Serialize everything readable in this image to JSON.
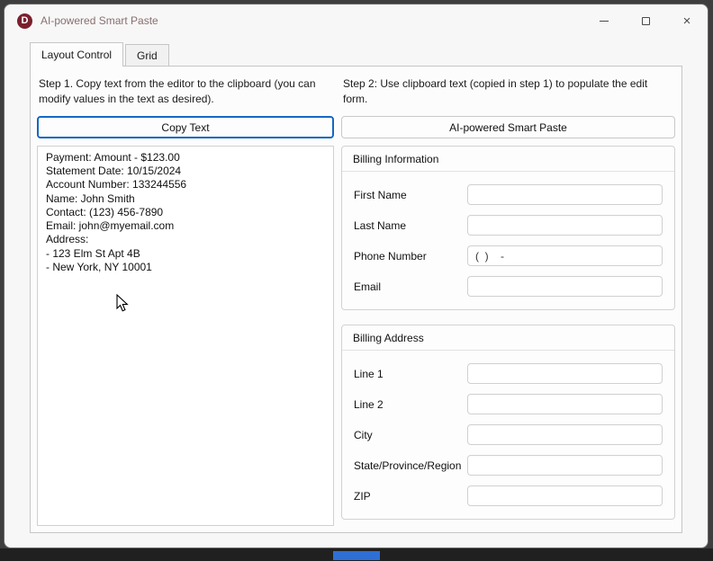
{
  "window": {
    "title": "AI-powered Smart Paste",
    "icon_letter": "D",
    "controls": {
      "close_glyph": "×"
    }
  },
  "colors": {
    "brand_red": "#7b1f2e",
    "focus_blue": "#1467c4",
    "taskbar_accent": "#2e6fd6"
  },
  "tabs": [
    {
      "label": "Layout Control",
      "active": true
    },
    {
      "label": "Grid",
      "active": false
    }
  ],
  "left": {
    "instruction": "Step 1. Copy text from the editor to the clipboard (you can modify values in the text as desired).",
    "copy_button_label": "Copy Text",
    "editor_text": "Payment: Amount - $123.00\nStatement Date: 10/15/2024\nAccount Number: 133244556\nName: John Smith\nContact: (123) 456-7890\nEmail: john@myemail.com\nAddress:\n- 123 Elm St Apt 4B\n- New York, NY 10001"
  },
  "right": {
    "instruction": "Step 2: Use clipboard text (copied in step 1) to populate the edit form.",
    "paste_button_label": "AI-powered Smart Paste",
    "groups": [
      {
        "title": "Billing Information",
        "fields": [
          {
            "label": "First Name",
            "value": ""
          },
          {
            "label": "Last Name",
            "value": ""
          },
          {
            "label": "Phone Number",
            "value": "(  )    -"
          },
          {
            "label": "Email",
            "value": ""
          }
        ]
      },
      {
        "title": "Billing Address",
        "fields": [
          {
            "label": "Line 1",
            "value": ""
          },
          {
            "label": "Line 2",
            "value": ""
          },
          {
            "label": "City",
            "value": ""
          },
          {
            "label": "State/Province/Region",
            "value": ""
          },
          {
            "label": "ZIP",
            "value": ""
          }
        ]
      }
    ]
  }
}
